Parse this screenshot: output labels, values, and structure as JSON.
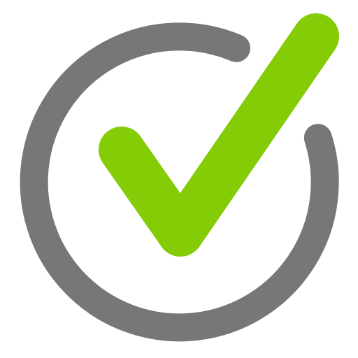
{
  "icon": {
    "name": "checkmark-in-circle-icon",
    "ring_color": "#777777",
    "check_color": "#84CC06",
    "background": "#FFFFFF"
  }
}
